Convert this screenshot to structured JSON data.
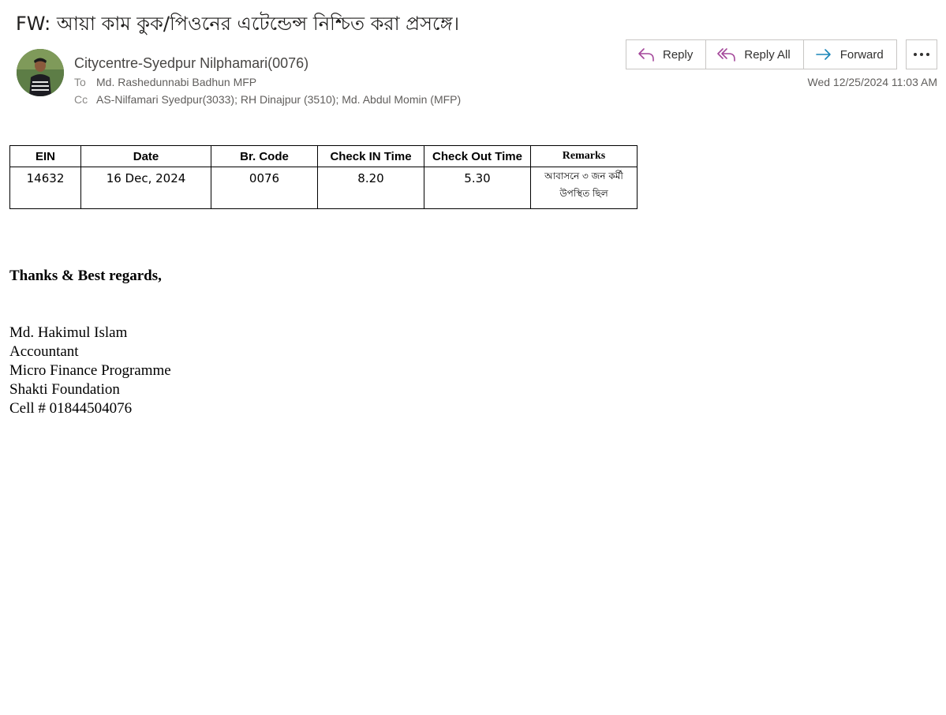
{
  "email": {
    "subject": "FW: আয়া কাম কুক/পিওনের এটেন্ডেন্স নিশ্চিত করা প্রসঙ্গে।",
    "sender": "Citycentre-Syedpur Nilphamari(0076)",
    "to_label": "To",
    "to": "Md. Rashedunnabi Badhun MFP",
    "cc_label": "Cc",
    "cc": "AS-Nilfamari Syedpur(3033); RH Dinajpur (3510); Md. Abdul Momin (MFP)",
    "date": "Wed 12/25/2024 11:03 AM"
  },
  "actions": {
    "reply": "Reply",
    "reply_all": "Reply All",
    "forward": "Forward"
  },
  "icons": {
    "reply": "reply-icon",
    "reply_all": "reply-all-icon",
    "forward": "forward-icon",
    "more": "more-icon"
  },
  "colors": {
    "reply_icon": "#a4479a",
    "forward_icon": "#1a86b8"
  },
  "table": {
    "headers": [
      "EIN",
      "Date",
      "Br. Code",
      "Check IN Time",
      "Check Out Time",
      "Remarks"
    ],
    "row": {
      "ein": "14632",
      "date": "16 Dec, 2024",
      "br_code": "0076",
      "check_in": "8.20",
      "check_out": "5.30",
      "remarks_line1": "আবাসনে ৩ জন কর্মী",
      "remarks_line2": "উপস্থিত ছিল"
    }
  },
  "signature": {
    "regards": "Thanks & Best regards,",
    "name": "Md. Hakimul Islam",
    "title": "Accountant",
    "dept": "Micro Finance Programme",
    "org": "Shakti Foundation",
    "cell": "Cell # 01844504076"
  }
}
